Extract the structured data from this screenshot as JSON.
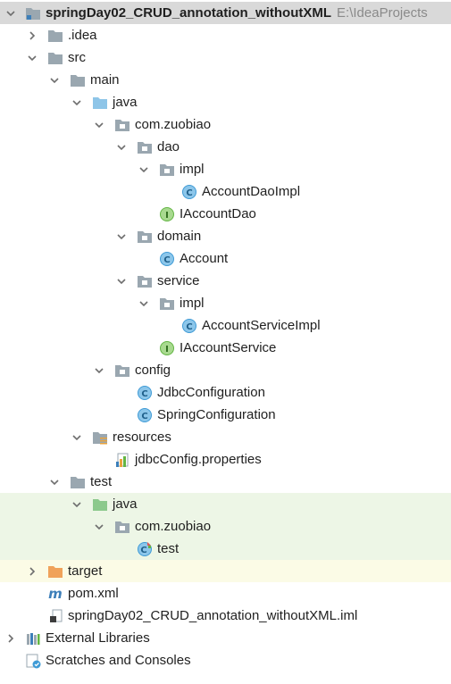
{
  "project": {
    "name": "springDay02_CRUD_annotation_withoutXML",
    "path": "E:\\IdeaProjects"
  },
  "nodes": {
    "idea": ".idea",
    "src": "src",
    "main": "main",
    "java_main": "java",
    "pkg_main": "com.zuobiao",
    "dao": "dao",
    "dao_impl": "impl",
    "account_dao_impl": "AccountDaoImpl",
    "iaccount_dao": "IAccountDao",
    "domain": "domain",
    "account": "Account",
    "service": "service",
    "service_impl": "impl",
    "account_service_impl": "AccountServiceImpl",
    "iaccount_service": "IAccountService",
    "config": "config",
    "jdbc_configuration": "JdbcConfiguration",
    "spring_configuration": "SpringConfiguration",
    "resources": "resources",
    "jdbc_config_properties": "jdbcConfig.properties",
    "test": "test",
    "java_test": "java",
    "pkg_test": "com.zuobiao",
    "test_class": "test",
    "target": "target",
    "pom": "pom.xml",
    "iml": "springDay02_CRUD_annotation_withoutXML.iml",
    "external_libraries": "External Libraries",
    "scratches": "Scratches and Consoles"
  },
  "colors": {
    "selected_row": "#d9d9d9",
    "test_row": "#edf6e6",
    "excluded_row": "#fbfbe6",
    "folder_gray": "#9aa7b0",
    "source_folder_blue": "#8ec5e8",
    "test_folder_green": "#8cc98c",
    "excluded_folder_orange": "#f0a25a",
    "class_icon": "#3f9bd6",
    "interface_icon": "#62b543"
  }
}
